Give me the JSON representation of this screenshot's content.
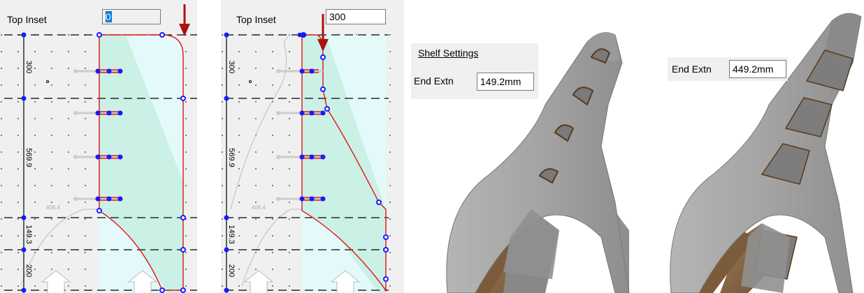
{
  "panel_left": {
    "top_inset_label": "Top Inset",
    "top_inset_value": "0",
    "dim_labels": [
      "300",
      "569.9",
      "149.3",
      "200"
    ],
    "faint_label": "406.4"
  },
  "panel_right": {
    "top_inset_label": "Top Inset",
    "top_inset_value": "300",
    "dim_labels": [
      "300",
      "569.9",
      "149.3",
      "200"
    ],
    "faint_label": "406.4"
  },
  "shelf_settings": {
    "title": "Shelf Settings",
    "end_extn_label": "End Extn",
    "end_extn_value": "149.2mm"
  },
  "second_view": {
    "end_extn_label": "End Extn",
    "end_extn_value": "449.2mm"
  },
  "colors": {
    "outline": "#e02020",
    "arrow": "#b01010",
    "node": "#1a1aff",
    "fill": "#e4fafa",
    "fill_band": "#c4efe2",
    "model_grey": "#a9a9a9",
    "model_wood": "#8a6a48"
  }
}
